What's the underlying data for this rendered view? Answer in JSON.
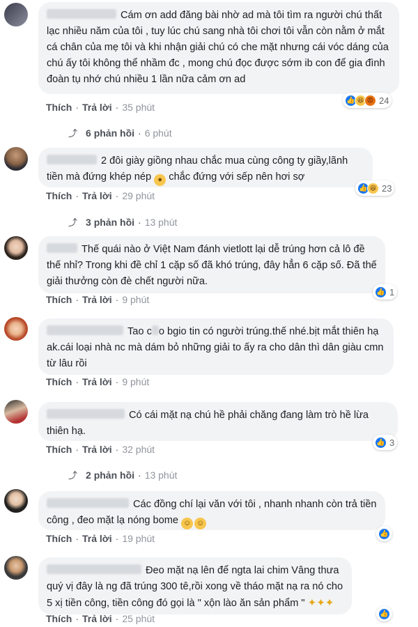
{
  "action_labels": {
    "like": "Thích",
    "reply": "Trả lời",
    "dot": "·"
  },
  "comments": [
    {
      "text": "Cám ơn add đăng bài nhờ ad mà tôi tìm ra người chú thất lạc nhiều năm của tôi , tuy lúc chú sang nhà tôi chơi tôi vẫn còn nằm ở mắt cá chân của mẹ tôi và khi nhận giải chú có che mặt nhưng cái vóc dáng của chú ấy tôi không thể nhầm đc , mong chú đọc được sớm ib con để gia đình đoàn tụ nhớ chú nhiều 1 lần nữa cảm ơn ad",
      "time": "35 phút",
      "reactions": {
        "types": [
          "like",
          "haha",
          "angry"
        ],
        "count": "24"
      },
      "replies": {
        "label": "6 phản hồi",
        "time": "6 phút"
      }
    },
    {
      "text": "2 đôi giày giồng nhau chắc mua cùng công ty giầy,lãnh tiền mà đứng khép nép",
      "text_after": "chắc đứng với sếp nên hơi sợ",
      "time": "29 phút",
      "reactions": {
        "types": [
          "like",
          "haha"
        ],
        "count": "23"
      },
      "replies": {
        "label": "3 phản hồi",
        "time": "13 phút"
      }
    },
    {
      "text": "Thế quái nào ở Việt Nam đánh vietlott lại dễ trúng hơn cả lô đề thế nhỉ? Trong khi đề chỉ 1 cặp số đã khó trúng, đây hẳn 6 cặp số. Đã thế giải thưởng còn đè chết người nữa.",
      "time": "9 phút",
      "reactions": {
        "types": [
          "like"
        ],
        "count": "1"
      }
    },
    {
      "text": "Tao c",
      "text_after": "o bgio tin có người trúng.thế nhé.bịt mắt thiên hạ ak.cái loại nhà nc mà dám bỏ những giải to ấy ra cho dân thì dân giàu cmn từ lâu rồi",
      "time": "9 phút"
    },
    {
      "text": "Có cái mặt nạ chú hề phải chăng đang làm trò hề lừa thiên hạ.",
      "time": "32 phút",
      "reactions": {
        "types": [
          "like"
        ],
        "count": "3"
      },
      "replies": {
        "label": "2 phản hồi",
        "time": "13 phút"
      }
    },
    {
      "text": "Các đồng chí lại văn với tôi , nhanh nhanh còn trả tiền công , đeo mặt lạ nóng bome",
      "time": "19 phút",
      "reactions": {
        "types": [
          "like"
        ],
        "count": ""
      }
    },
    {
      "text": "Đeo mặt nạ lên để ngta lai chim Vâng thưa quý vị đây là ng đã trúng 300 tê,rồi xong về tháo mặt nạ ra nó cho 5 xị tiền công, tiền công đó gọi là \" xộn lào ăn sản phẩm \"",
      "time": "25 phút",
      "reactions": {
        "types": [
          "like"
        ],
        "count": ""
      }
    }
  ],
  "colors": {
    "like": "#1877f2",
    "haha": "#f7c64d",
    "angry": "#e9710f",
    "bubble": "#f2f3f5"
  }
}
